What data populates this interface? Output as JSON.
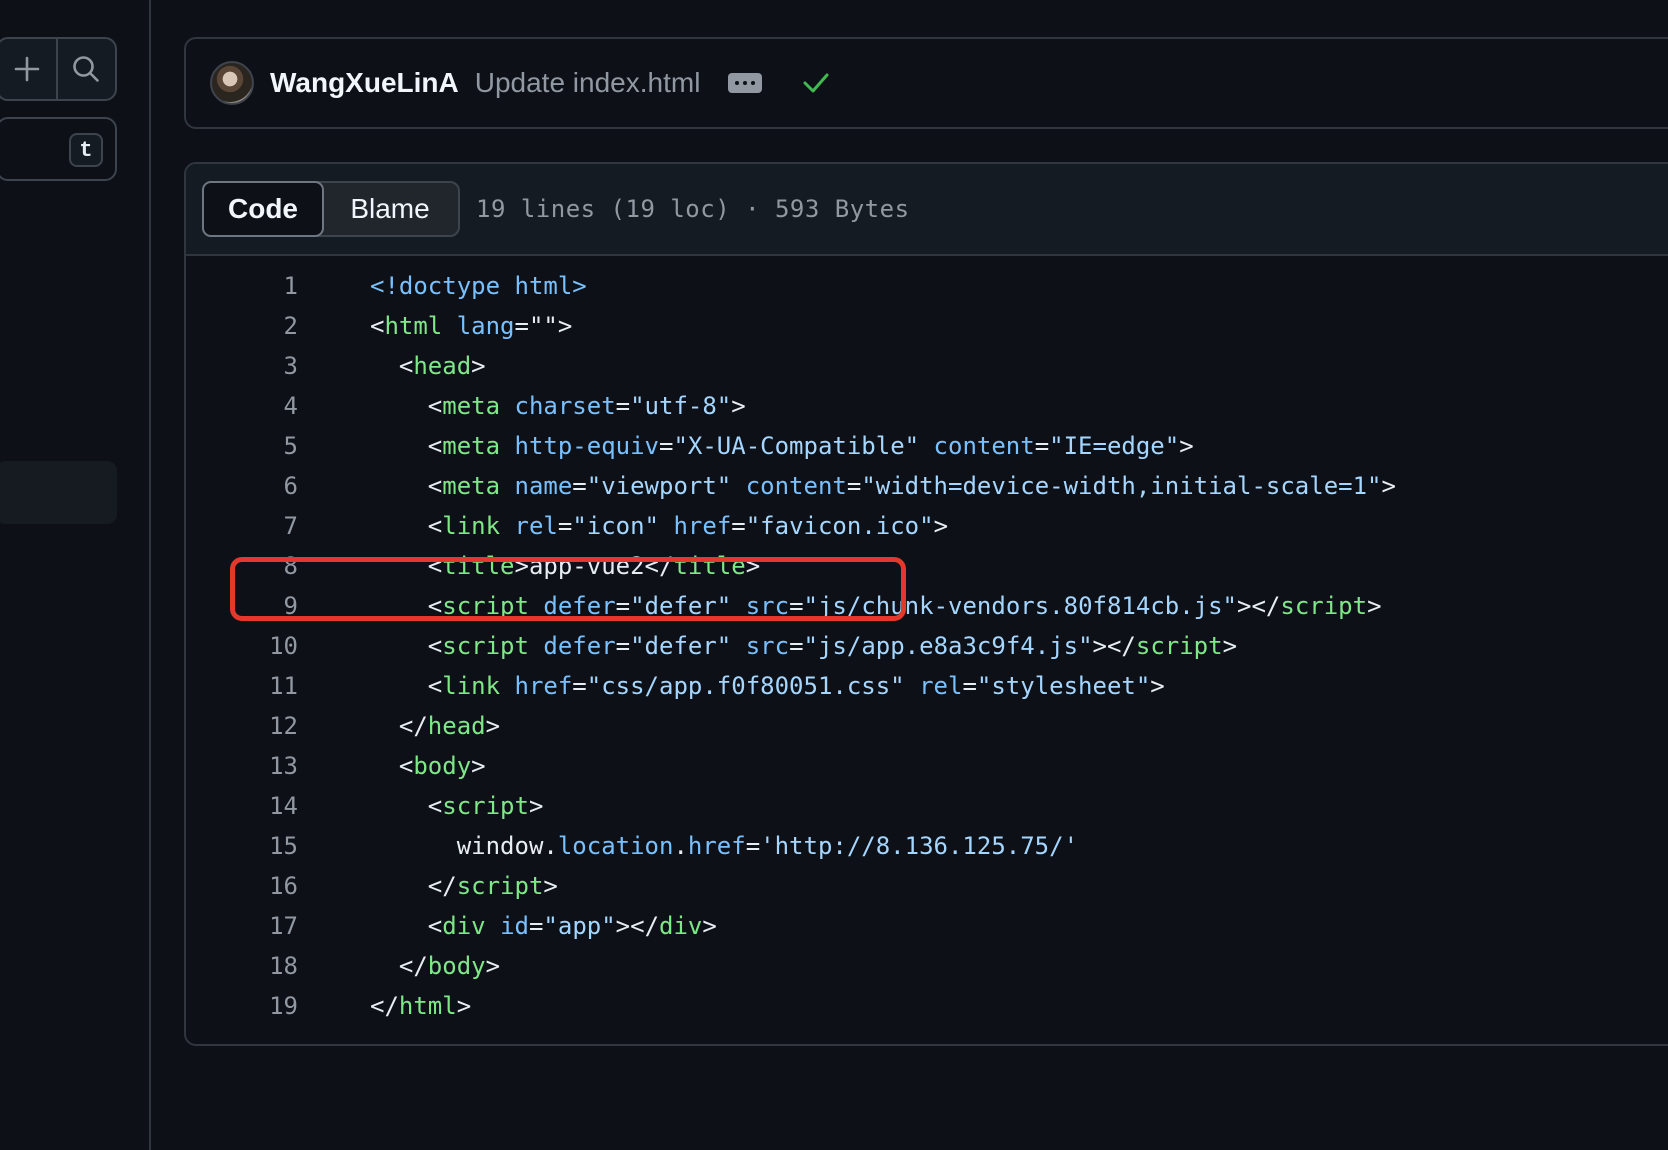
{
  "sidebar": {
    "add_icon": "plus-icon",
    "search_icon": "search-icon",
    "filter_shortcut": "t"
  },
  "commit": {
    "avatar": "avatar",
    "author": "WangXueLinA",
    "message": "Update index.html",
    "status": "success",
    "status_color": "#3fb950"
  },
  "file": {
    "tabs": [
      "Code",
      "Blame"
    ],
    "active_tab": "Code",
    "info": "19 lines (19 loc) · 593 Bytes"
  },
  "code": {
    "highlight_color": "#e5382c",
    "highlighted_line": 15,
    "lines": [
      {
        "n": "1",
        "tokens": [
          [
            "a",
            "<!doctype html>"
          ]
        ]
      },
      {
        "n": "2",
        "tokens": [
          [
            "p",
            "<"
          ],
          [
            "t",
            "html"
          ],
          [
            "p",
            " "
          ],
          [
            "a",
            "lang"
          ],
          [
            "p",
            "=\"\">"
          ]
        ]
      },
      {
        "n": "3",
        "tokens": [
          [
            "p",
            "  <"
          ],
          [
            "t",
            "head"
          ],
          [
            "p",
            ">"
          ]
        ]
      },
      {
        "n": "4",
        "tokens": [
          [
            "p",
            "    <"
          ],
          [
            "t",
            "meta"
          ],
          [
            "p",
            " "
          ],
          [
            "a",
            "charset"
          ],
          [
            "p",
            "="
          ],
          [
            "s",
            "\"utf-8\""
          ],
          [
            "p",
            ">"
          ]
        ]
      },
      {
        "n": "5",
        "tokens": [
          [
            "p",
            "    <"
          ],
          [
            "t",
            "meta"
          ],
          [
            "p",
            " "
          ],
          [
            "a",
            "http-equiv"
          ],
          [
            "p",
            "="
          ],
          [
            "s",
            "\"X-UA-Compatible\""
          ],
          [
            "p",
            " "
          ],
          [
            "a",
            "content"
          ],
          [
            "p",
            "="
          ],
          [
            "s",
            "\"IE=edge\""
          ],
          [
            "p",
            ">"
          ]
        ]
      },
      {
        "n": "6",
        "tokens": [
          [
            "p",
            "    <"
          ],
          [
            "t",
            "meta"
          ],
          [
            "p",
            " "
          ],
          [
            "a",
            "name"
          ],
          [
            "p",
            "="
          ],
          [
            "s",
            "\"viewport\""
          ],
          [
            "p",
            " "
          ],
          [
            "a",
            "content"
          ],
          [
            "p",
            "="
          ],
          [
            "s",
            "\"width=device-width,initial-scale=1\""
          ],
          [
            "p",
            ">"
          ]
        ]
      },
      {
        "n": "7",
        "tokens": [
          [
            "p",
            "    <"
          ],
          [
            "t",
            "link"
          ],
          [
            "p",
            " "
          ],
          [
            "a",
            "rel"
          ],
          [
            "p",
            "="
          ],
          [
            "s",
            "\"icon\""
          ],
          [
            "p",
            " "
          ],
          [
            "a",
            "href"
          ],
          [
            "p",
            "="
          ],
          [
            "s",
            "\"favicon.ico\""
          ],
          [
            "p",
            ">"
          ]
        ]
      },
      {
        "n": "8",
        "tokens": [
          [
            "p",
            "    <"
          ],
          [
            "t",
            "title"
          ],
          [
            "p",
            ">app-vue2</"
          ],
          [
            "t",
            "title"
          ],
          [
            "p",
            ">"
          ]
        ]
      },
      {
        "n": "9",
        "tokens": [
          [
            "p",
            "    <"
          ],
          [
            "t",
            "script"
          ],
          [
            "p",
            " "
          ],
          [
            "a",
            "defer"
          ],
          [
            "p",
            "="
          ],
          [
            "s",
            "\"defer\""
          ],
          [
            "p",
            " "
          ],
          [
            "a",
            "src"
          ],
          [
            "p",
            "="
          ],
          [
            "s",
            "\"js/chunk-vendors.80f814cb.js\""
          ],
          [
            "p",
            "></"
          ],
          [
            "t",
            "script"
          ],
          [
            "p",
            ">"
          ]
        ]
      },
      {
        "n": "10",
        "tokens": [
          [
            "p",
            "    <"
          ],
          [
            "t",
            "script"
          ],
          [
            "p",
            " "
          ],
          [
            "a",
            "defer"
          ],
          [
            "p",
            "="
          ],
          [
            "s",
            "\"defer\""
          ],
          [
            "p",
            " "
          ],
          [
            "a",
            "src"
          ],
          [
            "p",
            "="
          ],
          [
            "s",
            "\"js/app.e8a3c9f4.js\""
          ],
          [
            "p",
            "></"
          ],
          [
            "t",
            "script"
          ],
          [
            "p",
            ">"
          ]
        ]
      },
      {
        "n": "11",
        "tokens": [
          [
            "p",
            "    <"
          ],
          [
            "t",
            "link"
          ],
          [
            "p",
            " "
          ],
          [
            "a",
            "href"
          ],
          [
            "p",
            "="
          ],
          [
            "s",
            "\"css/app.f0f80051.css\""
          ],
          [
            "p",
            " "
          ],
          [
            "a",
            "rel"
          ],
          [
            "p",
            "="
          ],
          [
            "s",
            "\"stylesheet\""
          ],
          [
            "p",
            ">"
          ]
        ]
      },
      {
        "n": "12",
        "tokens": [
          [
            "p",
            "  </"
          ],
          [
            "t",
            "head"
          ],
          [
            "p",
            ">"
          ]
        ]
      },
      {
        "n": "13",
        "tokens": [
          [
            "p",
            "  <"
          ],
          [
            "t",
            "body"
          ],
          [
            "p",
            ">"
          ]
        ]
      },
      {
        "n": "14",
        "tokens": [
          [
            "p",
            "    <"
          ],
          [
            "t",
            "script"
          ],
          [
            "p",
            ">"
          ]
        ]
      },
      {
        "n": "15",
        "tokens": [
          [
            "p",
            "      window."
          ],
          [
            "a",
            "location"
          ],
          [
            "p",
            "."
          ],
          [
            "a",
            "href"
          ],
          [
            "p",
            "="
          ],
          [
            "s",
            "'http://8.136.125.75/'"
          ]
        ]
      },
      {
        "n": "16",
        "tokens": [
          [
            "p",
            "    </"
          ],
          [
            "t",
            "script"
          ],
          [
            "p",
            ">"
          ]
        ]
      },
      {
        "n": "17",
        "tokens": [
          [
            "p",
            "    <"
          ],
          [
            "t",
            "div"
          ],
          [
            "p",
            " "
          ],
          [
            "a",
            "id"
          ],
          [
            "p",
            "="
          ],
          [
            "s",
            "\"app\""
          ],
          [
            "p",
            "></"
          ],
          [
            "t",
            "div"
          ],
          [
            "p",
            ">"
          ]
        ]
      },
      {
        "n": "18",
        "tokens": [
          [
            "p",
            "  </"
          ],
          [
            "t",
            "body"
          ],
          [
            "p",
            ">"
          ]
        ]
      },
      {
        "n": "19",
        "tokens": [
          [
            "p",
            "</"
          ],
          [
            "t",
            "html"
          ],
          [
            "p",
            ">"
          ]
        ]
      }
    ]
  }
}
